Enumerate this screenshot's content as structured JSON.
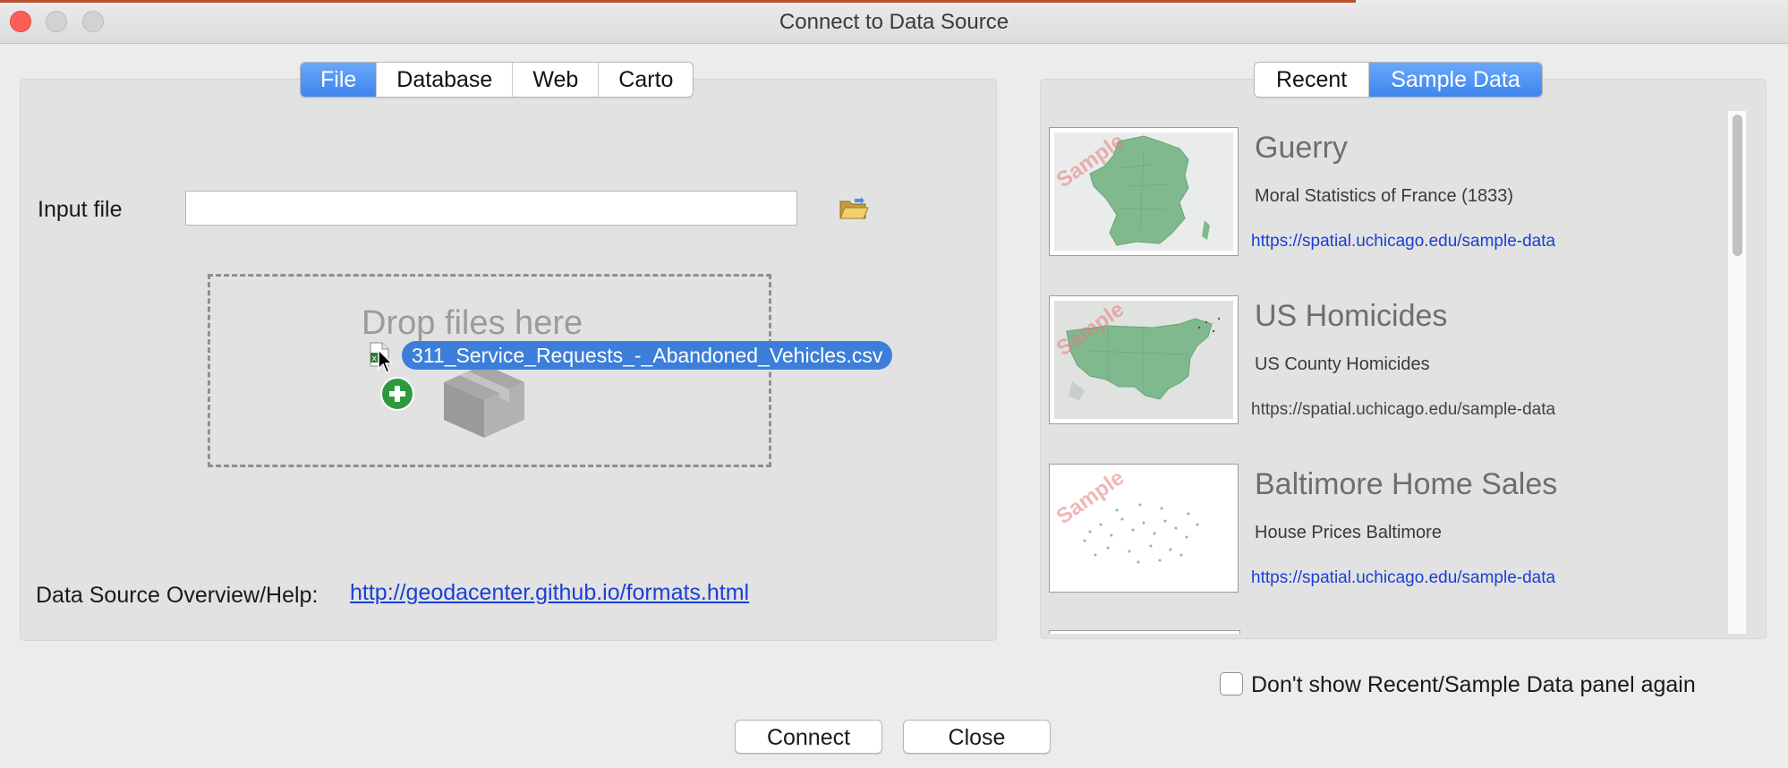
{
  "window": {
    "title": "Connect to Data Source"
  },
  "left_tabs": [
    {
      "label": "File",
      "active": true
    },
    {
      "label": "Database",
      "active": false
    },
    {
      "label": "Web",
      "active": false
    },
    {
      "label": "Carto",
      "active": false
    }
  ],
  "right_tabs": [
    {
      "label": "Recent",
      "active": false
    },
    {
      "label": "Sample Data",
      "active": true
    }
  ],
  "file_panel": {
    "input_label": "Input file",
    "input_value": "",
    "drop_text": "Drop files here",
    "dragged_file": "311_Service_Requests_-_Abandoned_Vehicles.csv",
    "help_label": "Data Source Overview/Help:",
    "help_link": "http://geodacenter.github.io/formats.html"
  },
  "sample_data": {
    "watermark": "Sample",
    "items": [
      {
        "title": "Guerry",
        "description": "Moral Statistics of France (1833)",
        "link": "https://spatial.uchicago.edu/sample-data"
      },
      {
        "title": "US Homicides",
        "description": "US County Homicides",
        "link": "https://spatial.uchicago.edu/sample-data"
      },
      {
        "title": "Baltimore Home Sales",
        "description": "House Prices Baltimore",
        "link": "https://spatial.uchicago.edu/sample-data"
      }
    ]
  },
  "footer": {
    "checkbox_label": "Don't show Recent/Sample Data panel again",
    "checkbox_checked": false,
    "connect_label": "Connect",
    "close_label": "Close"
  },
  "colors": {
    "accent": "#3d86ee",
    "link": "#1a3fd6",
    "map_green": "#7fb98d",
    "close_button": "#fc5f57"
  }
}
